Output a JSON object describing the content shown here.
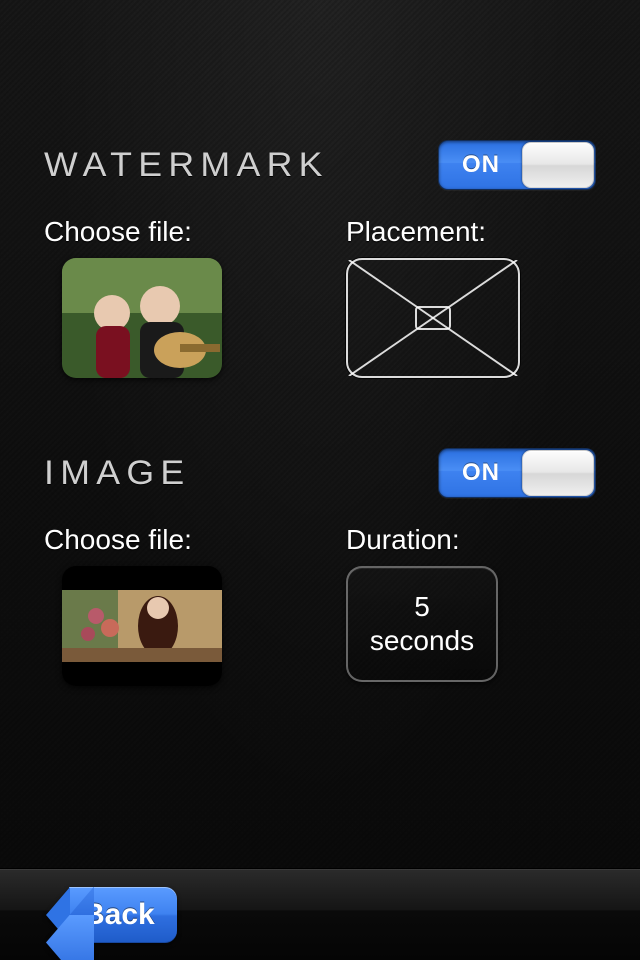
{
  "sections": {
    "watermark": {
      "title": "Watermark",
      "toggle": {
        "state": "ON"
      },
      "choose_label": "Choose file:",
      "placement_label": "Placement:",
      "placement_selected": "center"
    },
    "image": {
      "title": "Image",
      "toggle": {
        "state": "ON"
      },
      "choose_label": "Choose file:",
      "duration_label": "Duration:",
      "duration_value": "5",
      "duration_unit": "seconds"
    }
  },
  "footer": {
    "back_label": "Back"
  },
  "colors": {
    "accent_blue": "#3e82f0",
    "panel_border": "#c0c0c0"
  }
}
